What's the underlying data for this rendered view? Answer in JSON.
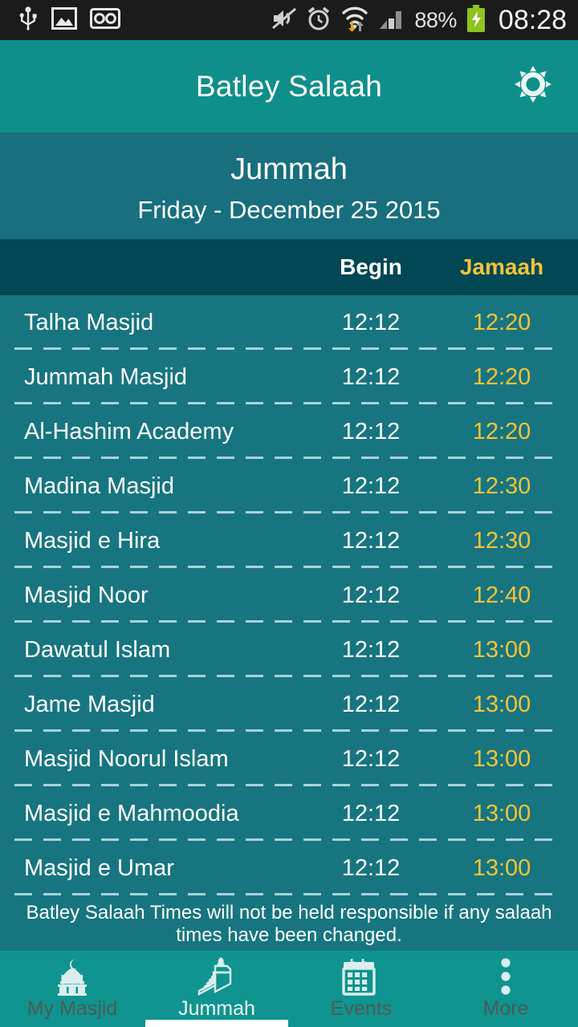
{
  "status_bar": {
    "left_icons": [
      "usb-icon",
      "image-icon",
      "voicemail-icon"
    ],
    "right_icons": [
      "mute-icon",
      "alarm-icon",
      "wifi-icon",
      "signal-icon"
    ],
    "battery_percent": "88%",
    "battery_state": "charging",
    "clock": "08:28"
  },
  "app_bar": {
    "title": "Batley Salaah",
    "settings_icon": "gear-icon"
  },
  "title_block": {
    "prayer_name": "Jummah",
    "date": "Friday - December 25 2015"
  },
  "table": {
    "columns": [
      "",
      "Begin",
      "Jamaah"
    ],
    "rows": [
      {
        "masjid": "Talha Masjid",
        "begin": "12:12",
        "jamaah": "12:20"
      },
      {
        "masjid": "Jummah Masjid",
        "begin": "12:12",
        "jamaah": "12:20"
      },
      {
        "masjid": "Al-Hashim Academy",
        "begin": "12:12",
        "jamaah": "12:20"
      },
      {
        "masjid": "Madina Masjid",
        "begin": "12:12",
        "jamaah": "12:30"
      },
      {
        "masjid": "Masjid e Hira",
        "begin": "12:12",
        "jamaah": "12:30"
      },
      {
        "masjid": "Masjid Noor",
        "begin": "12:12",
        "jamaah": "12:40"
      },
      {
        "masjid": "Dawatul Islam",
        "begin": "12:12",
        "jamaah": "13:00"
      },
      {
        "masjid": "Jame Masjid",
        "begin": "12:12",
        "jamaah": "13:00"
      },
      {
        "masjid": "Masjid Noorul Islam",
        "begin": "12:12",
        "jamaah": "13:00"
      },
      {
        "masjid": "Masjid e Mahmoodia",
        "begin": "12:12",
        "jamaah": "13:00"
      },
      {
        "masjid": "Masjid e Umar",
        "begin": "12:12",
        "jamaah": "13:00"
      }
    ]
  },
  "disclaimer": "Batley Salaah Times will not be held responsible if any salaah times have been changed.",
  "bottom_nav": {
    "items": [
      {
        "label": "My Masjid",
        "icon": "mosque-dome-icon",
        "active": false
      },
      {
        "label": "Jummah",
        "icon": "minbar-icon",
        "active": true
      },
      {
        "label": "Events",
        "icon": "calendar-icon",
        "active": false
      },
      {
        "label": "More",
        "icon": "overflow-dots-icon",
        "active": false
      }
    ]
  },
  "colors": {
    "app_bar": "#0f8f8a",
    "title_block": "#186f7e",
    "column_header": "#024754",
    "table_bg": "#17757f",
    "accent_jamaah": "#f5c33b",
    "bottom_nav": "#0f9490"
  }
}
